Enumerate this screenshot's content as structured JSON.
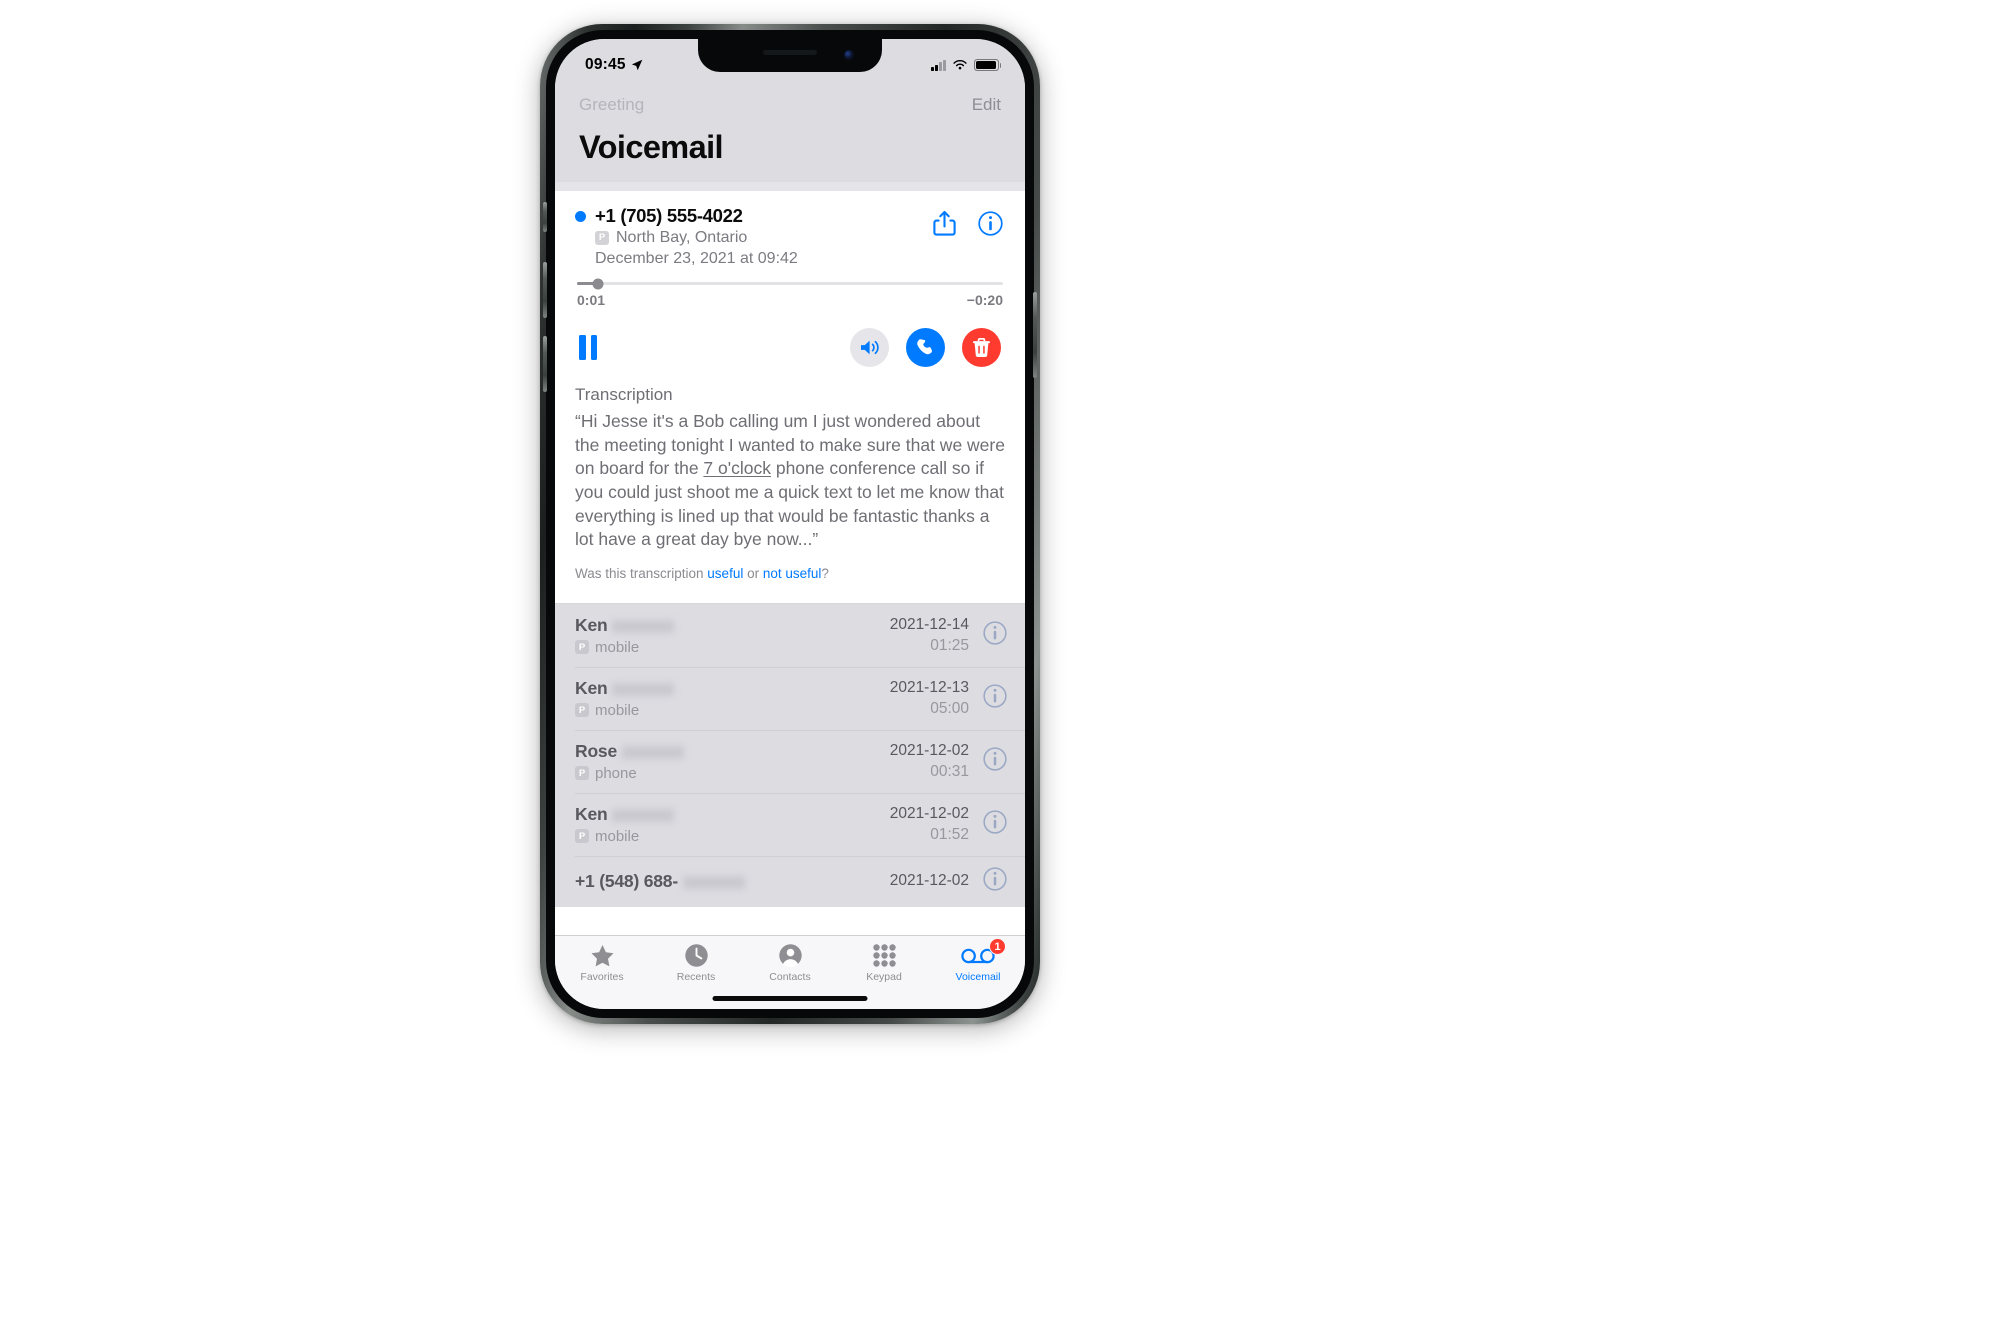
{
  "status_bar": {
    "time": "09:45",
    "location_icon": "location-arrow-icon",
    "cellular_icon": "cellular-signal-icon",
    "wifi_icon": "wifi-icon",
    "battery_icon": "battery-icon"
  },
  "nav": {
    "greeting_label": "Greeting",
    "edit_label": "Edit",
    "title": "Voicemail"
  },
  "voicemail_detail": {
    "number": "+1 (705) 555-4022",
    "carrier_badge": "P",
    "location": "North Bay, Ontario",
    "date": "December 23, 2021 at 09:42",
    "elapsed": "0:01",
    "remaining": "−0:20",
    "progress_percent": 5,
    "share_icon": "share-icon",
    "info_icon": "info-circle-icon",
    "pause_icon": "pause-icon",
    "speaker_icon": "speaker-icon",
    "call_icon": "phone-call-icon",
    "delete_icon": "trash-icon",
    "accent_blue": "#007aff",
    "delete_red": "#ff3b30"
  },
  "transcription": {
    "heading": "Transcription",
    "text_before": "“Hi Jesse it's a Bob calling um I just wondered about the meeting tonight I wanted to make sure that we were on board for the ",
    "highlight": "7 o'clock",
    "text_after": " phone conference call so if you could just shoot me a quick text to let me know that everything is lined up that would be fantastic thanks a lot have a great day bye now...”",
    "feedback_prefix": "Was this transcription ",
    "feedback_useful": "useful",
    "feedback_or": " or ",
    "feedback_not_useful": "not useful",
    "feedback_suffix": "?"
  },
  "voicemail_list": [
    {
      "name": "Ken",
      "redacted": true,
      "badge": "P",
      "type": "mobile",
      "date": "2021-12-14",
      "duration": "01:25",
      "info_icon": "info-circle-icon"
    },
    {
      "name": "Ken",
      "redacted": true,
      "badge": "P",
      "type": "mobile",
      "date": "2021-12-13",
      "duration": "05:00",
      "info_icon": "info-circle-icon"
    },
    {
      "name": "Rose",
      "redacted": true,
      "badge": "P",
      "type": "phone",
      "date": "2021-12-02",
      "duration": "00:31",
      "info_icon": "info-circle-icon"
    },
    {
      "name": "Ken",
      "redacted": true,
      "badge": "P",
      "type": "mobile",
      "date": "2021-12-02",
      "duration": "01:52",
      "info_icon": "info-circle-icon"
    },
    {
      "name": "+1 (548) 688-",
      "redacted": true,
      "badge": "",
      "type": "",
      "date": "2021-12-02",
      "duration": "",
      "info_icon": "info-circle-icon"
    }
  ],
  "tab_bar": {
    "tabs": [
      {
        "label": "Favorites",
        "icon": "star-icon",
        "active": false
      },
      {
        "label": "Recents",
        "icon": "clock-icon",
        "active": false
      },
      {
        "label": "Contacts",
        "icon": "person-circle-icon",
        "active": false
      },
      {
        "label": "Keypad",
        "icon": "keypad-icon",
        "active": false
      },
      {
        "label": "Voicemail",
        "icon": "voicemail-icon",
        "active": true,
        "badge": "1"
      }
    ]
  }
}
